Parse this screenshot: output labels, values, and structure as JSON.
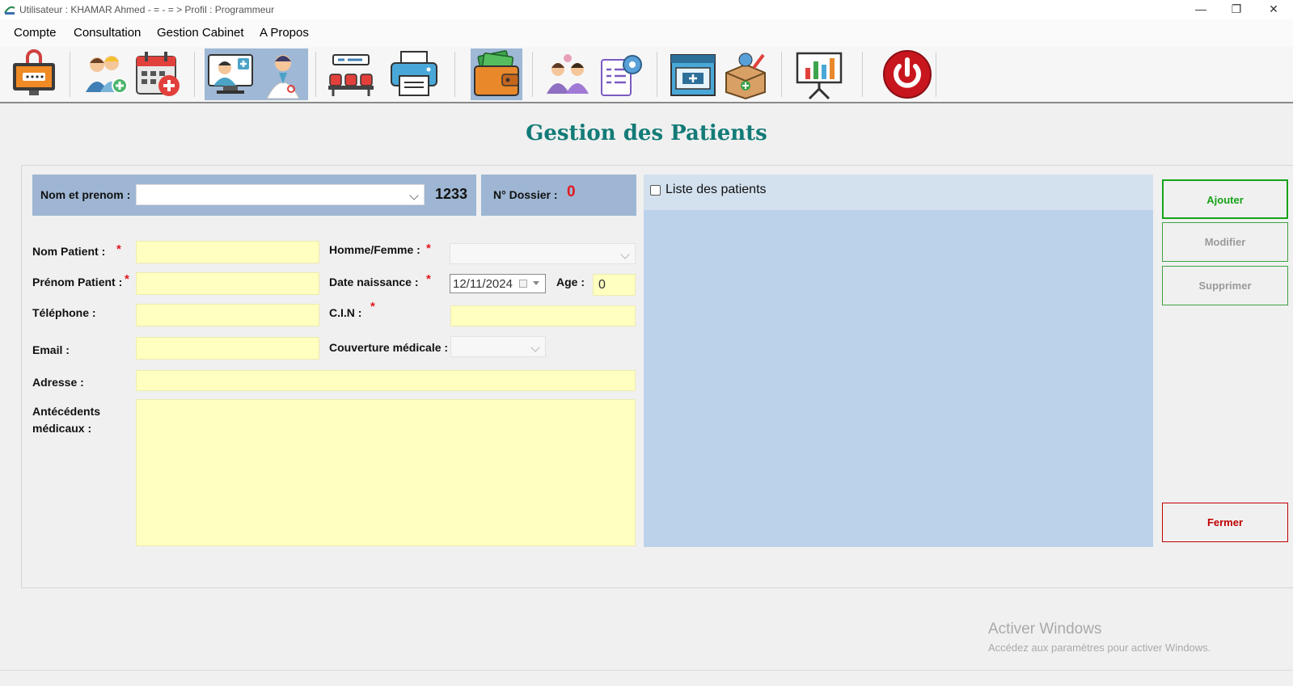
{
  "window": {
    "title": "Utilisateur : KHAMAR  Ahmed - = - = > Profil : Programmeur",
    "controls": {
      "minimize": "—",
      "restore": "❐",
      "close": "✕"
    }
  },
  "menu": [
    "Compte",
    "Consultation",
    "Gestion Cabinet",
    "A Propos"
  ],
  "toolbar": {
    "icons": [
      "login-screen-icon",
      "patients-icon",
      "calendar-icon",
      "doctor-computer-icon",
      "doctor-icon",
      "waiting-room-icon",
      "printer-icon",
      "wallet-icon",
      "staff-icon",
      "settings-report-icon",
      "pharmacy-icon",
      "medical-box-icon",
      "statistics-icon",
      "power-icon"
    ]
  },
  "page": {
    "title": "Gestion des Patients"
  },
  "header": {
    "nom_prenom_label": "Nom et prenom :",
    "count": "1233",
    "dossier_label": "N° Dossier :",
    "dossier_value": "0"
  },
  "form": {
    "nom_label": "Nom Patient :",
    "prenom_label": "Prénom Patient :",
    "telephone_label": "Téléphone :",
    "email_label": "Email :",
    "adresse_label": "Adresse :",
    "antecedents_label_1": "Antécédents",
    "antecedents_label_2": "médicaux :",
    "sexe_label": "Homme/Femme :",
    "date_label": "Date naissance :",
    "date_value": "12/11/2024",
    "age_label": "Age :",
    "age_value": "0",
    "cin_label": "C.I.N  :",
    "couverture_label": "Couverture médicale :",
    "required_mark": "*"
  },
  "list": {
    "checkbox_label": "Liste des patients"
  },
  "buttons": {
    "ajouter": "Ajouter",
    "modifier": "Modifier",
    "supprimer": "Supprimer",
    "fermer": "Fermer"
  },
  "watermark": {
    "line1": "Activer Windows",
    "line2": "Accédez aux paramètres pour activer Windows."
  },
  "colors": {
    "title": "#137b77",
    "required": "#e0191e",
    "dossier_value": "#e0191e",
    "panel": "#9eb6d3",
    "list_bg": "#bcd1ea",
    "input_bg": "#ffffc0",
    "ajouter": "#16a316",
    "fermer": "#c00000"
  }
}
